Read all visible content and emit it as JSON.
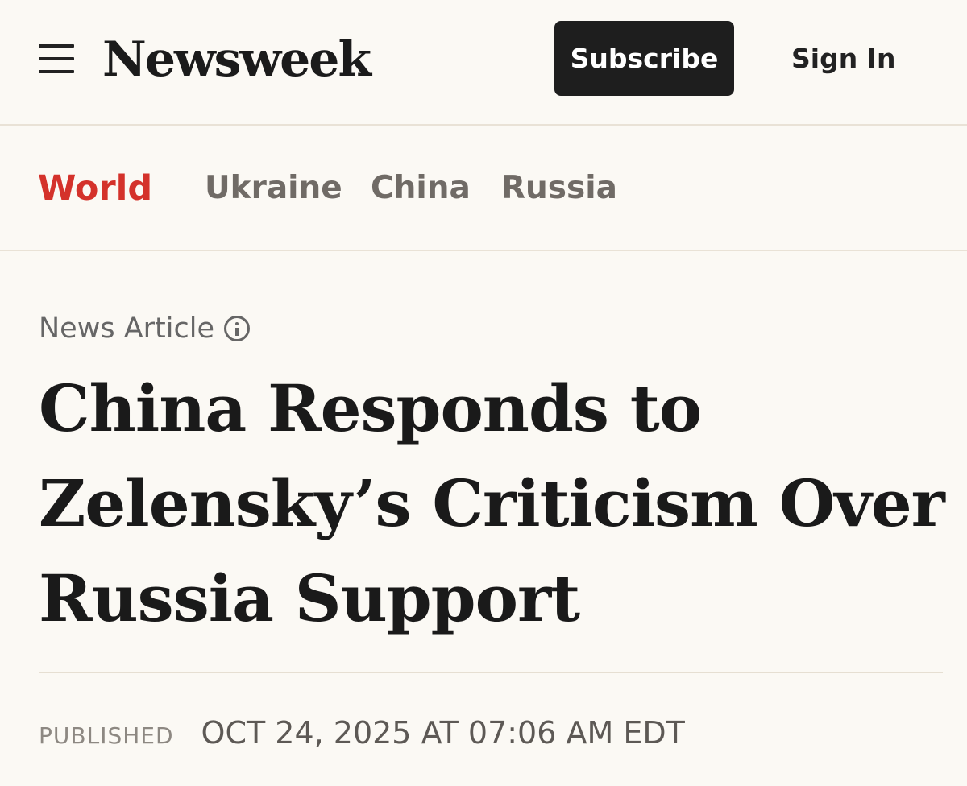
{
  "header": {
    "menu_icon": "hamburger-menu-icon",
    "logo_text": "Newsweek",
    "subscribe_label": "Subscribe",
    "signin_label": "Sign In"
  },
  "nav": {
    "items": [
      {
        "label": "World",
        "active": true
      },
      {
        "label": "Ukraine",
        "active": false
      },
      {
        "label": "China",
        "active": false
      },
      {
        "label": "Russia",
        "active": false
      }
    ],
    "active_color": "#d4322b"
  },
  "article": {
    "type_label": "News Article",
    "info_icon": "info-circle-icon",
    "headline": "China Responds to Zelensky’s Criticism Over Russia Support",
    "published_label": "PUBLISHED",
    "published_date": "OCT 24, 2025 AT 07:06 AM EDT"
  }
}
